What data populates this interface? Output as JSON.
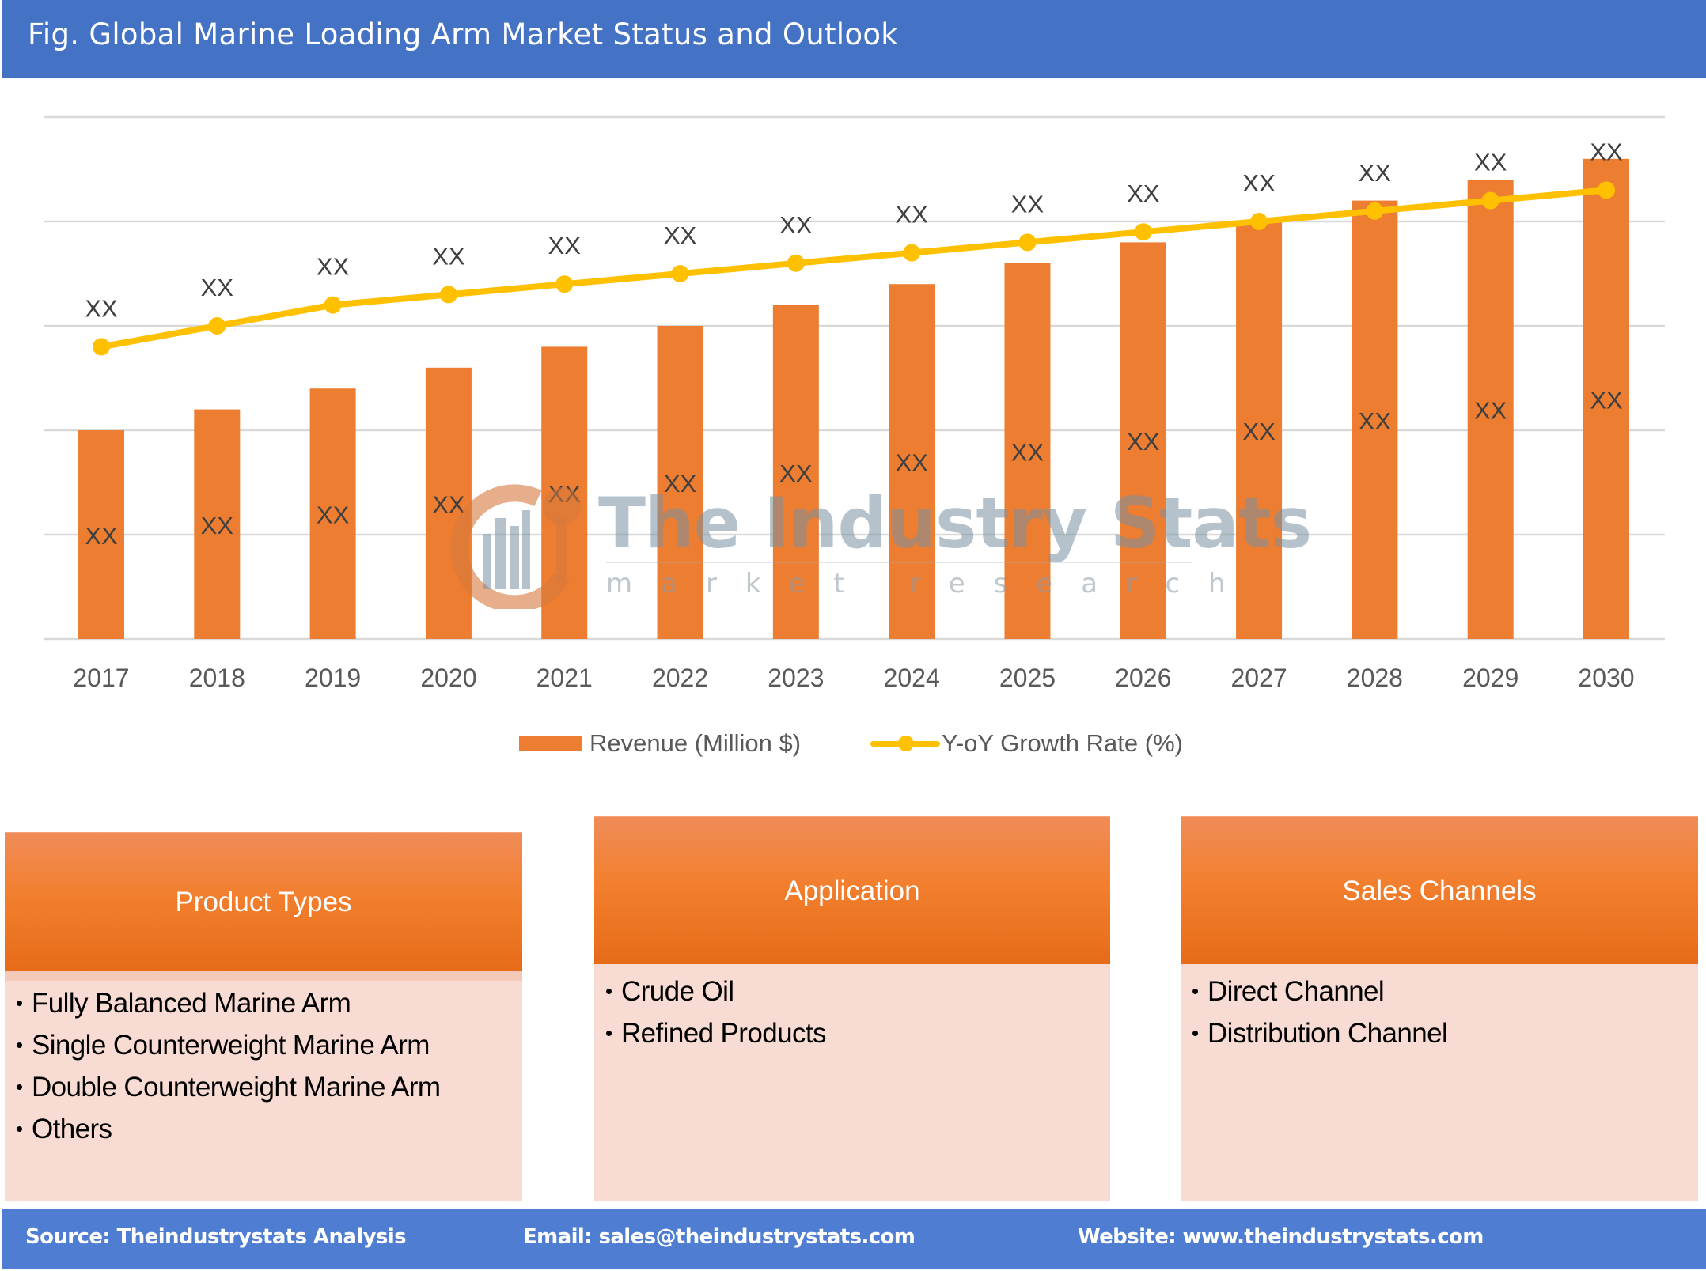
{
  "header": {
    "title": "Fig. Global Marine Loading Arm Market Status and Outlook"
  },
  "colors": {
    "title_bar": "#4472C4",
    "revenue_bar": "#ED7D31",
    "growth_line": "#FFC000",
    "segment_header": "#F27F2E",
    "segment_body": "#F8DBD2",
    "footer": "#4E7DD2"
  },
  "chart_data": {
    "type": "bar",
    "title": "",
    "xlabel": "",
    "ylabel": "",
    "categories": [
      "2017",
      "2018",
      "2019",
      "2020",
      "2021",
      "2022",
      "2023",
      "2024",
      "2025",
      "2026",
      "2027",
      "2028",
      "2029",
      "2030"
    ],
    "series": [
      {
        "name": "Revenue (Million $)",
        "type": "bar",
        "values": [
          2.0,
          2.2,
          2.4,
          2.6,
          2.8,
          3.0,
          3.2,
          3.4,
          3.6,
          3.8,
          4.0,
          4.2,
          4.4,
          4.6
        ],
        "data_labels": [
          "XX",
          "XX",
          "XX",
          "XX",
          "XX",
          "XX",
          "XX",
          "XX",
          "XX",
          "XX",
          "XX",
          "XX",
          "XX",
          "XX"
        ]
      },
      {
        "name": "Y-oY Growth Rate (%)",
        "type": "line",
        "values": [
          2.8,
          3.0,
          3.2,
          3.3,
          3.4,
          3.5,
          3.6,
          3.7,
          3.8,
          3.9,
          4.0,
          4.1,
          4.2,
          4.3
        ],
        "data_labels": [
          "XX",
          "XX",
          "XX",
          "XX",
          "XX",
          "XX",
          "XX",
          "XX",
          "XX",
          "XX",
          "XX",
          "XX",
          "XX",
          "XX"
        ]
      }
    ],
    "ylim": [
      0,
      5
    ],
    "yticks_labeled": false,
    "grid": true,
    "legend_position": "bottom-center",
    "note": "Values are relative (axis unlabeled; data labels masked as XX)"
  },
  "watermark": {
    "brand": "The Industry Stats",
    "tagline": "market research"
  },
  "segments": [
    {
      "title": "Product Types",
      "items": [
        "Fully Balanced Marine Arm",
        "Single Counterweight Marine Arm",
        "Double Counterweight Marine Arm",
        "Others"
      ]
    },
    {
      "title": "Application",
      "items": [
        "Crude Oil",
        "Refined Products"
      ]
    },
    {
      "title": "Sales Channels",
      "items": [
        "Direct Channel",
        "Distribution Channel"
      ]
    }
  ],
  "bullet": "•",
  "footer": {
    "source": "Source: Theindustrystats Analysis",
    "email": "Email: sales@theindustrystats.com",
    "website": "Website: www.theindustrystats.com"
  }
}
